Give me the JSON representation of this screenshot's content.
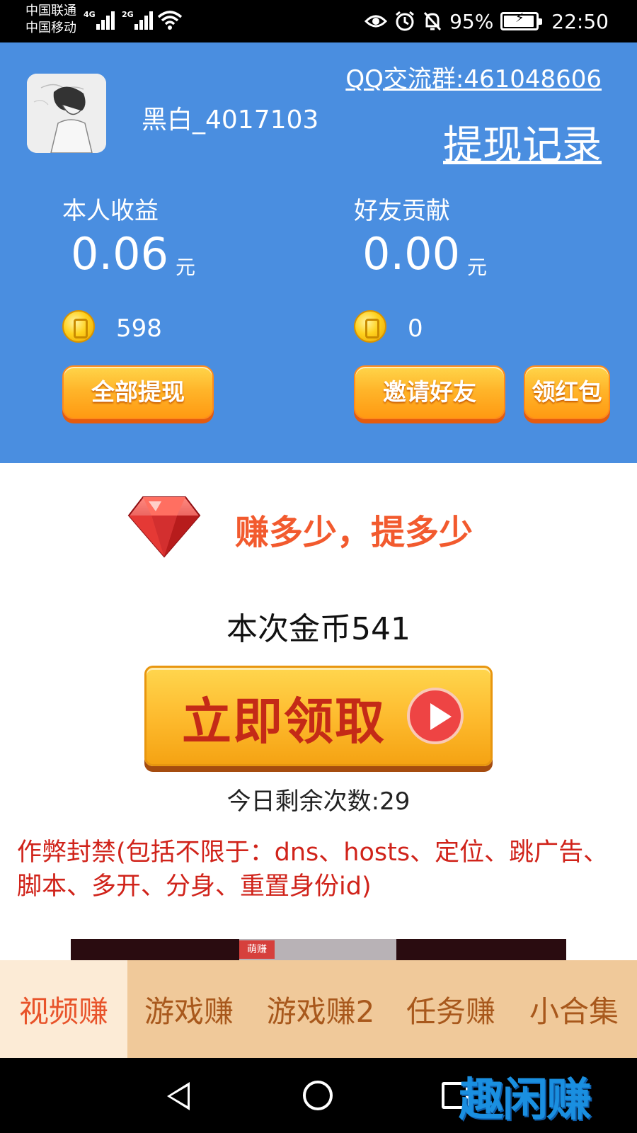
{
  "status_bar": {
    "carrier_1": "中国联通",
    "carrier_2": "中国移动",
    "net_1": "4G",
    "net_2": "2G",
    "battery_percent": "95%",
    "battery_level": 0.95,
    "time": "22:50",
    "icons": [
      "wifi-icon",
      "eye-icon",
      "alarm-icon",
      "mute-bell-icon",
      "battery-icon"
    ]
  },
  "header": {
    "username": "黑白_4017103",
    "qq_group": "QQ交流群:461048606",
    "withdraw_record": "提现记录",
    "my_earnings": {
      "label": "本人收益",
      "amount": "0.06",
      "unit": "元",
      "coins": "598"
    },
    "friend_contribution": {
      "label": "好友贡献",
      "amount": "0.00",
      "unit": "元",
      "coins": "0"
    },
    "buttons": {
      "withdraw_all": "全部提现",
      "invite_friends": "邀请好友",
      "red_packet": "领红包"
    }
  },
  "main": {
    "slogan": "赚多少，提多少",
    "coins_this_time": "本次金币541",
    "claim_button": "立即领取",
    "remaining_today": "今日剩余次数:29",
    "warning": "作弊封禁(包括不限于：dns、hosts、定位、跳广告、脚本、多开、分身、重置身份id)",
    "ad_logo_text": "萌赚"
  },
  "tabs": [
    {
      "label": "视频赚",
      "active": true
    },
    {
      "label": "游戏赚",
      "active": false
    },
    {
      "label": "游戏赚2",
      "active": false
    },
    {
      "label": "任务赚",
      "active": false
    },
    {
      "label": "小合集",
      "active": false
    }
  ],
  "watermark": "趣闲赚",
  "colors": {
    "header_blue": "#4A8EE0",
    "slogan_orange": "#F25A2E",
    "warning_red": "#D0231A",
    "tab_bar": "#F0C99A",
    "tab_active_bg": "#FCEBD6",
    "tab_active_text": "#E8532A",
    "tab_text": "#A8581C"
  }
}
